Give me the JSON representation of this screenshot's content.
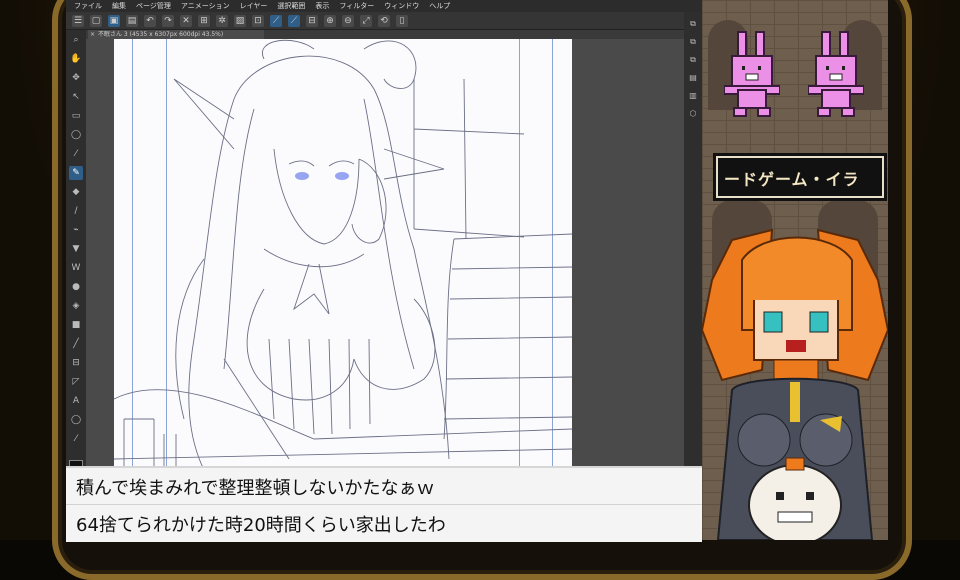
{
  "app": {
    "menu": [
      "ファイル",
      "編集",
      "ページ管理",
      "アニメーション",
      "レイヤー",
      "選択範囲",
      "表示",
      "フィルター",
      "ウィンドウ",
      "ヘルプ"
    ],
    "tab_title": "不眠さん 3 (4535 x 6307px 600dpi 43.5%)"
  },
  "subtitles": {
    "line1": "積んで埃まみれで整理整頓しないかたなぁｗ",
    "line2": "64捨てられかけた時20時間くらい家出したわ"
  },
  "panel": {
    "banner_text": "ードゲーム・イラ"
  },
  "icons": {
    "tools": [
      "zoom-icon",
      "hand-icon",
      "rotate-icon",
      "move-icon",
      "select-icon",
      "lasso-icon",
      "eyedropper-icon",
      "pen-icon",
      "eraser-icon",
      "brush-icon",
      "airbrush-icon",
      "fill-icon",
      "gradient-icon",
      "line-icon",
      "frame-icon",
      "text-icon",
      "balloon-icon",
      "ruler-icon"
    ]
  },
  "colors": {
    "accent": "#2f5f88",
    "paper": "#fbfbfd",
    "guide": "#8aa4d8",
    "hair": "#ee7a1e",
    "bunny": "#ec8fe6"
  }
}
